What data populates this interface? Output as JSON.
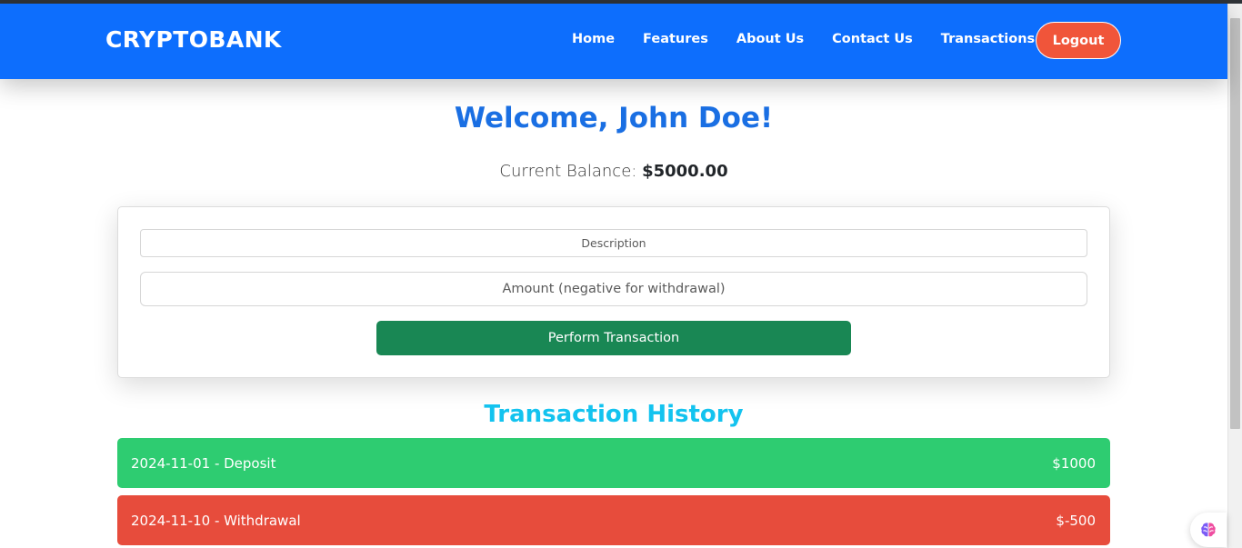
{
  "brand": {
    "name": "CRYPTOBANK"
  },
  "nav": {
    "links": [
      "Home",
      "Features",
      "About Us",
      "Contact Us",
      "Transactions"
    ],
    "logout_label": "Logout"
  },
  "welcome": {
    "text": "Welcome, John Doe!"
  },
  "balance": {
    "label": "Current Balance:",
    "amount": "$5000.00"
  },
  "form": {
    "description_placeholder": "Description",
    "amount_placeholder": "Amount (negative for withdrawal)",
    "submit_label": "Perform Transaction"
  },
  "history": {
    "title": "Transaction History",
    "transactions": [
      {
        "text": "2024-11-01 - Deposit",
        "amount": "$1000",
        "type": "deposit",
        "color": "#2ecc71"
      },
      {
        "text": "2024-11-10 - Withdrawal",
        "amount": "$-500",
        "type": "withdrawal",
        "color": "#e74c3c"
      }
    ]
  },
  "colors": {
    "navbar": "#0d6efd",
    "logout": "#f0553a",
    "welcome": "#1a6fe3",
    "submit": "#198754",
    "history_title": "#13c3ef"
  },
  "widget": {
    "icon": "brain-icon"
  }
}
